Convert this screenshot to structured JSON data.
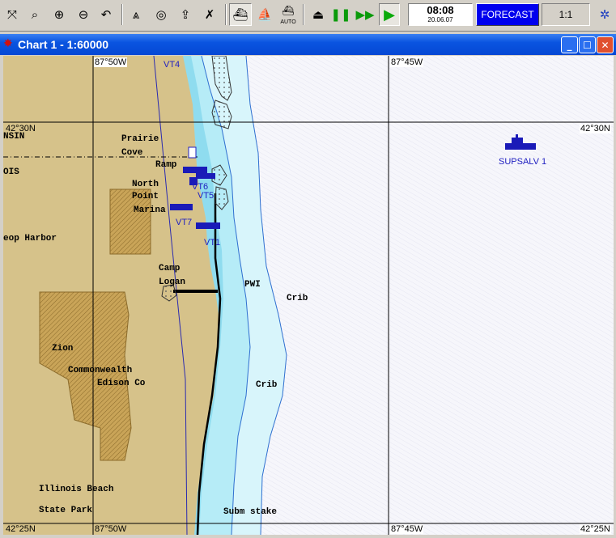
{
  "toolbar": {
    "tools": [
      "zoom-extent",
      "zoom-window",
      "zoom-in",
      "zoom-out",
      "undo-view",
      "sextant",
      "target",
      "export",
      "delete"
    ],
    "modes": [
      "ship-view",
      "vessel-view",
      "auto"
    ],
    "auto_label": "AUTO",
    "playback": [
      "stop",
      "pause",
      "fast-forward",
      "play"
    ],
    "time": "08:08",
    "date": "20.06.07",
    "forecast_label": "FORECAST",
    "scale_label": "1:1"
  },
  "window": {
    "title": "Chart 1 - 1:60000",
    "controls": [
      "minimize",
      "maximize",
      "close"
    ]
  },
  "chart": {
    "coordinates": {
      "lon_left_top": "87°50W",
      "lon_right_top": "87°45W",
      "lat_top_left": "42°30N",
      "lat_top_right": "42°30N",
      "lat_bottom_left": "42°25N",
      "lat_bottom_right": "42°25N",
      "lon_left_bottom": "87°50W",
      "lon_right_bottom": "87°45W"
    },
    "places": {
      "nsin": "NSIN",
      "ois": "OIS",
      "prairie": "Prairie",
      "cove": "Cove",
      "ramp": "Ramp",
      "north": "North",
      "point": "Point",
      "marina": "Marina",
      "harbor": "eop Harbor",
      "camp": "Camp",
      "logan": "Logan",
      "pwi": "PWI",
      "crib1": "Crib",
      "crib2": "Crib",
      "zion": "Zion",
      "commonwealth": "Commonwealth",
      "edison": "Edison Co",
      "illinois": "Illinois Beach",
      "state_park": "State Park",
      "subm": "Subm stake"
    },
    "targets": [
      "VT4",
      "VT6",
      "VT5",
      "VT7",
      "VT1"
    ],
    "vessel": "SUPSALV 1",
    "colors": {
      "land": "#d6c28a",
      "park": "#c19a4c",
      "shallow": "#8fdcef",
      "mid": "#c8f0f8",
      "deep": "#f4f4fa",
      "target": "#1a1ab8"
    }
  }
}
